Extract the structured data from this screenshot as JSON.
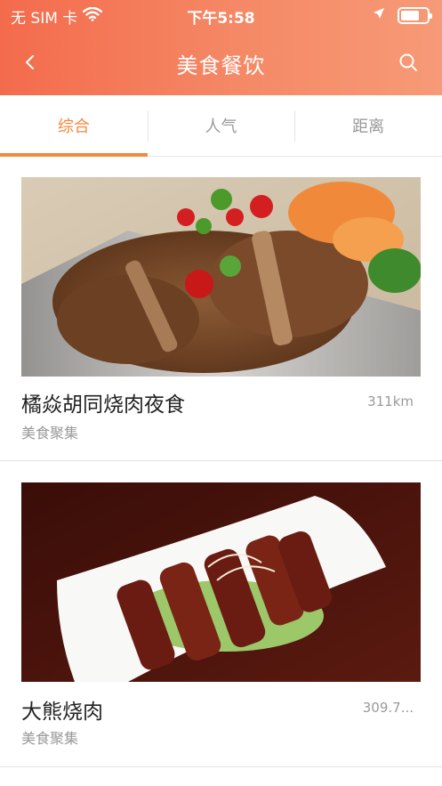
{
  "status_bar": {
    "carrier": "无 SIM 卡",
    "time": "下午5:58",
    "battery_level": 0.7
  },
  "nav": {
    "title": "美食餐饮",
    "back_icon": "chevron-left-icon",
    "search_icon": "search-icon"
  },
  "tabs": [
    {
      "label": "综合",
      "active": true
    },
    {
      "label": "人气",
      "active": false
    },
    {
      "label": "距离",
      "active": false
    }
  ],
  "colors": {
    "header_gradient_start": "#f36b4c",
    "header_gradient_end": "#f79a77",
    "accent": "#f28a3d",
    "muted_text": "#9a9a9a"
  },
  "listings": [
    {
      "name": "橘焱胡同烧肉夜食",
      "distance": "311km",
      "category": "美食聚集"
    },
    {
      "name": "大熊烧肉",
      "distance": "309.7...",
      "category": "美食聚集"
    }
  ]
}
